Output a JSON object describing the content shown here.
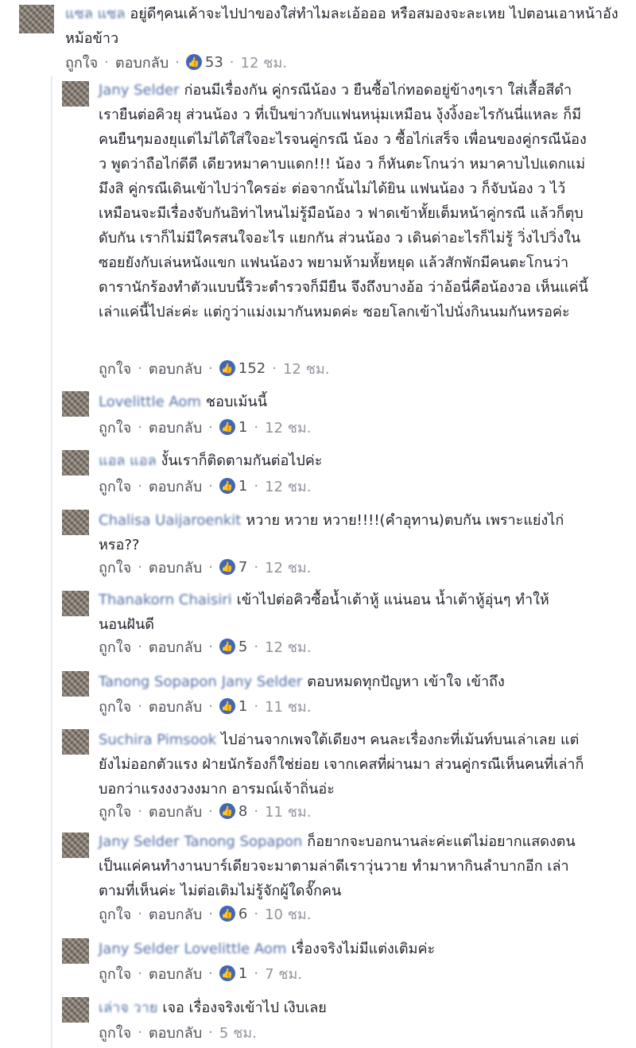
{
  "actions": {
    "like": "ถูกใจ",
    "reply": "ตอบกลับ",
    "dot": "·"
  },
  "icons": {
    "like": "like-thumb-icon"
  },
  "colors": {
    "author": "#365899",
    "meta": "#90949c",
    "like_badge": "#4267b2"
  },
  "comments": [
    {
      "author": "แซล แซล",
      "text": "อยู่ดีๆคนเค้าจะไปปาของใส่ทำไมละเอ้อออ หรือสมองจะละเหย ไปตอนเอาหน้าอังหม้อข้าว",
      "likes": "53",
      "time": "12 ชม."
    },
    {
      "author": "Jany Selder",
      "text": "ก่อนมีเรื่องกัน คู่กรณีน้อง ว ยืนซื้อไก่ทอดอยู่ข้างๆเรา ใส่เสื้อสีดำ เรายืนต่อคิวยุ ส่วนน้อง ว ที่เป็นข่าวกับแฟนหนุ่มเหมือน งุ้งงิ้งอะไรกันนี่แหละ ก็มีคนยืนๆมองยุแต่ไม่ได้ใส่ใจอะไรจนคู่กรณี น้อง ว ซื้อไก่เสร็จ เพื่อนของคู่กรณีน้อง ว พูดว่าถือไก่ดีดี เดียวหมาคาบแดก!!! น้อง ว ก็หันตะโกนว่า หมาคาบไปแดกแม่มึงสิ คู่กรณีเดินเข้าไปว่าใครอ่ะ ต่อจากนั้นไม่ได้ยิน แฟนน้อง ว ก็จับน้อง ว ไว้เหมือนจะมีเรื่องจับกันอิท่าไหนไม่รู้มือน้อง ว ฟาดเข้าหั้ยเต็มหน้าคู่กรณี แล้วก็ตุบดับกัน เราก็ไม่มีใครสนใจอะไร แยกกัน ส่วนน้อง ว เดินด่าอะไรก็ไม่รู้ วิ่งไปวิ่งในซอยยังกับเล่นหนังแขก แฟนน้องว พยามห้ามหั้ยหยุด แล้วสักพักมีคนตะโกนว่าดารานักร้องทำตัวแบบนี้ริวะตำรวจก็มียืน จึงถึงบางอ้อ ว่าอ้อนี่คือน้องวอ เห็นแค่นี้เล่าแค่นี้ไปล่ะค่ะ แต่กูว่าแม่งเมากันหมดค่ะ ซอยโลกเข้าไปนั่งกินนมกันหรอค่ะ",
      "likes": "152",
      "time": "12 ชม."
    },
    {
      "author": "Lovelittle Aom",
      "text": "ชอบเม้นนี้",
      "likes": "1",
      "time": "12 ชม."
    },
    {
      "author": "แอล แอล",
      "text": "งั้นเราก็ติดตามกันต่อไปค่ะ",
      "likes": "1",
      "time": "12 ชม."
    },
    {
      "author": "Chalisa Uaijaroenkit",
      "text": "หวาย หวาย หวาย!!!!(คำอุทาน)ตบกัน เพราะแย่งไก่หรอ??",
      "likes": "7",
      "time": "12 ชม."
    },
    {
      "author": "Thanakorn Chaisiri",
      "text": "เข้าไปต่อคิวซื้อน้ำเต้าหู้ แน่นอน น้ำเต้าหู้อุ่นๆ ทำให้นอนฝันดี",
      "likes": "5",
      "time": "12 ชม."
    },
    {
      "author": "Tanong Sopapon",
      "tag": "Jany Selder",
      "text": "ตอบหมดทุกปัญหา เข้าใจ เข้าถึง",
      "likes": "1",
      "time": "11 ชม."
    },
    {
      "author": "Suchira Pimsook",
      "text": "ไปอ่านจากเพจใต้เดียงฯ คนละเรื่องกะที่เม้นท์บนเล่าเลย แต่ยังไม่ออกตัวแรง ฝ่ายนักร้องก็ใช่ย่อย เจากเคสที่ผ่านมา ส่วนคู่กรณีเห็นคนที่เล่าก็บอกว่าแรงงงวงงมาก อารมณ์เจ้าถิ่นอ่ะ",
      "likes": "8",
      "time": "11 ชม."
    },
    {
      "author": "Jany Selder",
      "tag": "Tanong Sopapon",
      "text": "ก็อยากจะบอกนานล่ะค่ะแต่ไม่อยากแสดงตน เป็นแค่คนทำงานบาร์เดียวจะมาตามล่าดีเราวุ่นวาย ทำมาหากินลำบากอีก เล่าตามที่เห็นค่ะ ไม่ต่อเติมไม่รู้จักผู้ใดจั๊กคน",
      "likes": "6",
      "time": "10 ชม."
    },
    {
      "author": "Jany Selder",
      "tag": "Lovelittle Aom",
      "text": "เรื่องจริงไม่มีแต่งเติมค่ะ",
      "likes": "1",
      "time": "7 ชม."
    },
    {
      "author": "เล่าจ วาย",
      "text": "เจอ เรื่องจริงเข้าไป เงิบเลย",
      "time": "5 ชม."
    }
  ]
}
